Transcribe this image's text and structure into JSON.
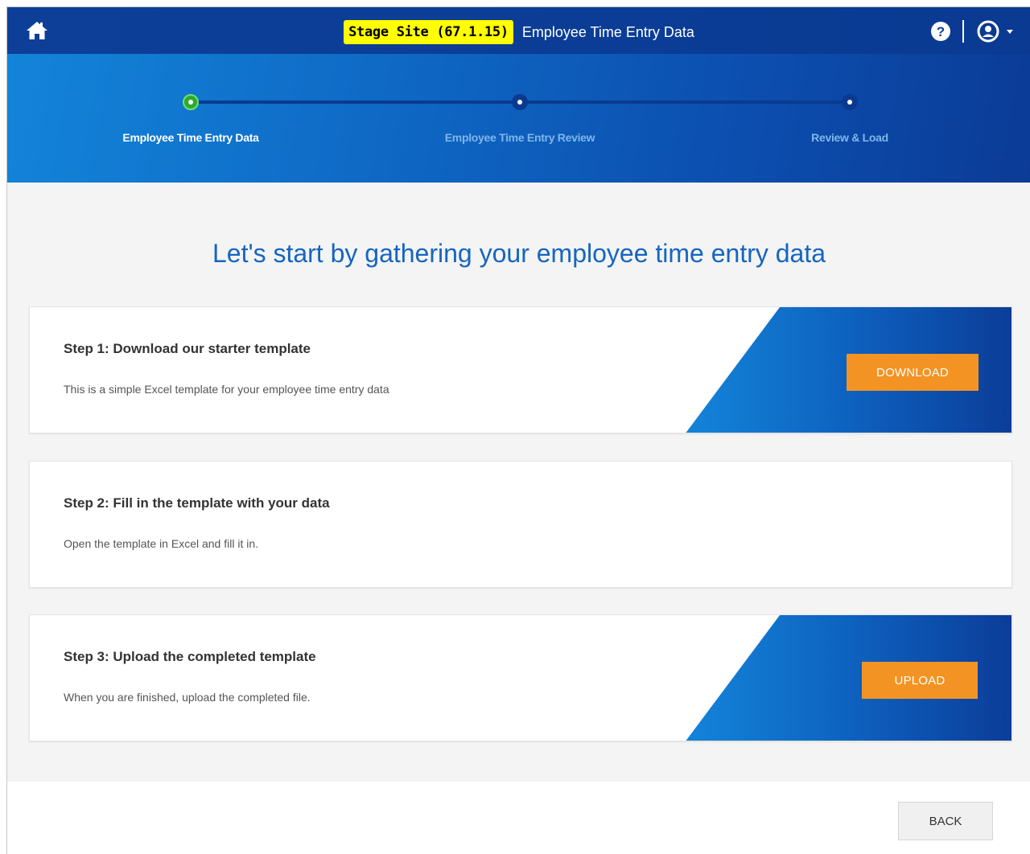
{
  "header": {
    "stage_badge": "Stage Site (67.1.15)",
    "title": "Employee Time Entry Data",
    "icons": {
      "home": "home-icon",
      "help": "help-icon",
      "user": "user-icon",
      "caret": "caret-down-icon"
    }
  },
  "stepper": {
    "steps": [
      {
        "label": "Employee Time Entry Data",
        "active": true
      },
      {
        "label": "Employee Time Entry Review",
        "active": false
      },
      {
        "label": "Review & Load",
        "active": false
      }
    ]
  },
  "main": {
    "headline": "Let's start by gathering your employee time entry data",
    "cards": [
      {
        "heading": "Step 1: Download our starter template",
        "description": "This is a simple Excel template for your employee time entry data",
        "button_label": "DOWNLOAD"
      },
      {
        "heading": "Step 2: Fill in the template with your data",
        "description": "Open the template in Excel and fill it in."
      },
      {
        "heading": "Step 3: Upload the completed template",
        "description": "When you are finished, upload the completed file.",
        "button_label": "UPLOAD"
      }
    ]
  },
  "footer": {
    "back_label": "BACK"
  },
  "colors": {
    "header_bg": "#0d3f99",
    "badge_bg": "#ffff00",
    "accent_orange": "#f39323",
    "headline_blue": "#1565c0",
    "active_step": "#2eaa2e"
  }
}
